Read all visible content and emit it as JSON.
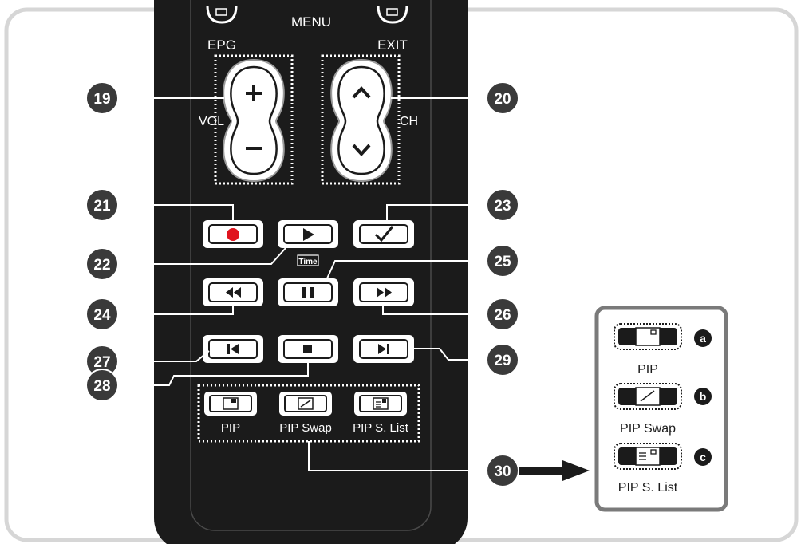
{
  "remote": {
    "menu_label": "MENU",
    "epg_label": "EPG",
    "exit_label": "EXIT",
    "vol_label": "VOL",
    "ch_label": "CH",
    "time_label": "Time",
    "pip_labels": [
      "PIP",
      "PIP Swap",
      "PIP S. List"
    ]
  },
  "callouts": [
    "19",
    "20",
    "21",
    "22",
    "23",
    "24",
    "25",
    "26",
    "27",
    "28",
    "29",
    "30"
  ],
  "inset": {
    "items": [
      {
        "letter": "a",
        "label": "PIP"
      },
      {
        "letter": "b",
        "label": "PIP Swap"
      },
      {
        "letter": "c",
        "label": "PIP S. List"
      }
    ]
  },
  "colors": {
    "remote_body": "#1b1b1b",
    "callout_fill": "#3a3a3a",
    "frame_border": "#d6d6d6",
    "record_dot": "#e0141e"
  }
}
